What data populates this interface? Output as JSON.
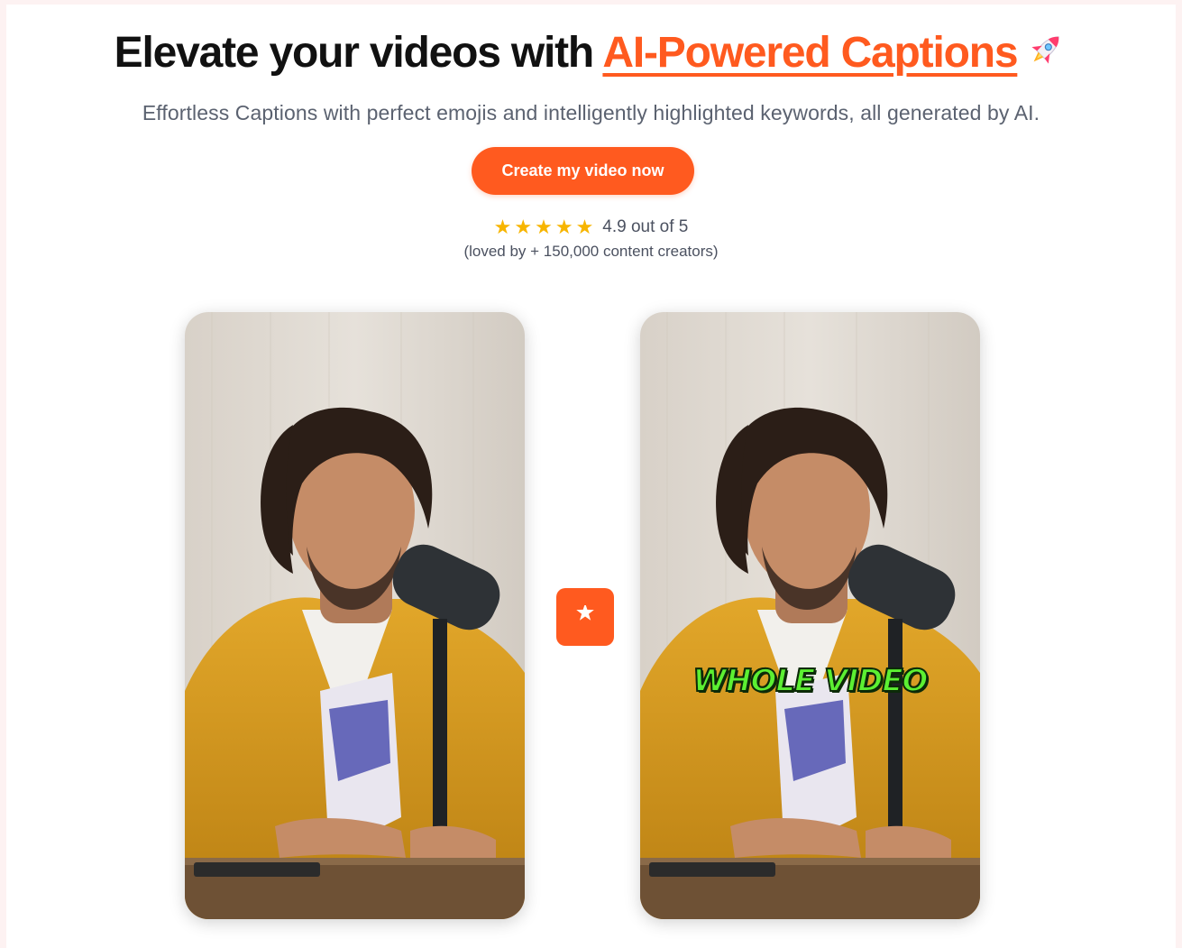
{
  "hero": {
    "title_prefix": "Elevate your videos with ",
    "title_accent": "AI-Powered Captions",
    "subtitle": "Effortless Captions with perfect emojis and intelligently highlighted keywords, all generated by AI.",
    "cta_label": "Create my video now"
  },
  "rating": {
    "stars": 5,
    "score_text": "4.9 out of 5",
    "loved_text": "(loved by + 150,000 content creators)"
  },
  "comparison": {
    "after_caption": "WHOLE VIDEO"
  },
  "icons": {
    "title_icon": "rocket-icon",
    "rating_icon": "star-icon",
    "transform_icon": "sparkle-icon"
  },
  "colors": {
    "accent": "#ff5a1f",
    "star": "#f7b500",
    "caption_fill": "#5cf032"
  }
}
